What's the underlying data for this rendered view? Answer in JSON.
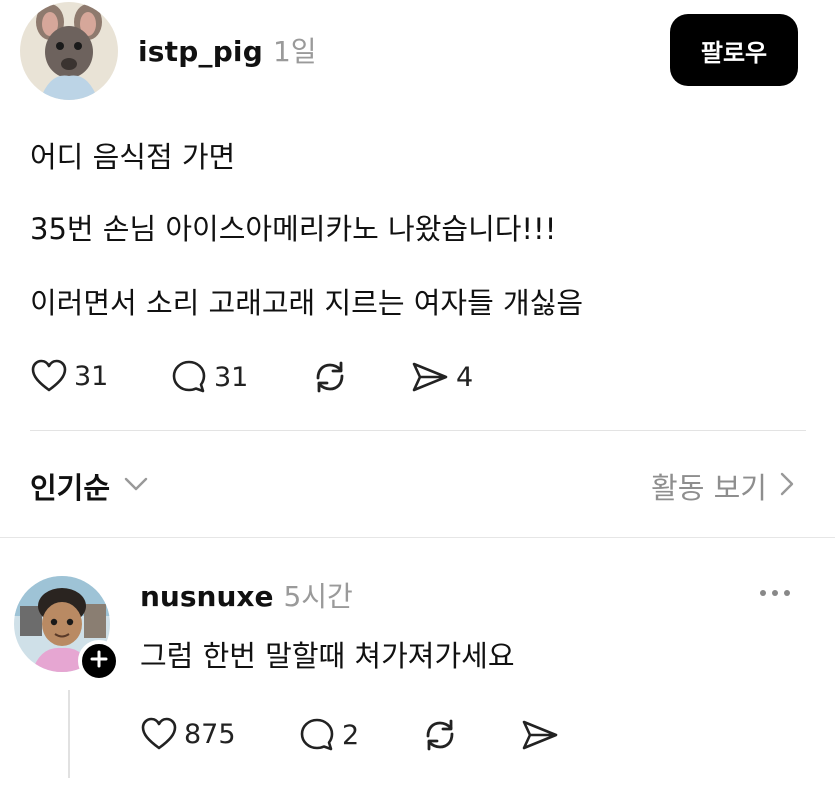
{
  "post": {
    "username": "istp_pig",
    "time": "1일",
    "follow_label": "팔로우",
    "lines": [
      "어디 음식점 가면",
      "35번 손님 아이스아메리카노 나왔습니다!!!",
      "이러면서 소리 고래고래 지르는 여자들 개싫음"
    ],
    "actions": {
      "likes": "31",
      "comments": "31",
      "shares": "4"
    }
  },
  "sort": {
    "label": "인기순",
    "activity_label": "활동 보기"
  },
  "reply": {
    "username": "nusnuxe",
    "time": "5시간",
    "text": "그럼 한번 말할때 쳐가져가세요",
    "actions": {
      "likes": "875",
      "comments": "2"
    }
  },
  "icons": {
    "like": "heart-icon",
    "comment": "comment-bubble-icon",
    "repost": "repost-icon",
    "share": "send-icon",
    "sort_toggle": "chevron-down-icon",
    "activity": "chevron-right-icon",
    "follow_badge": "plus-icon",
    "more": "more-dots-icon"
  }
}
